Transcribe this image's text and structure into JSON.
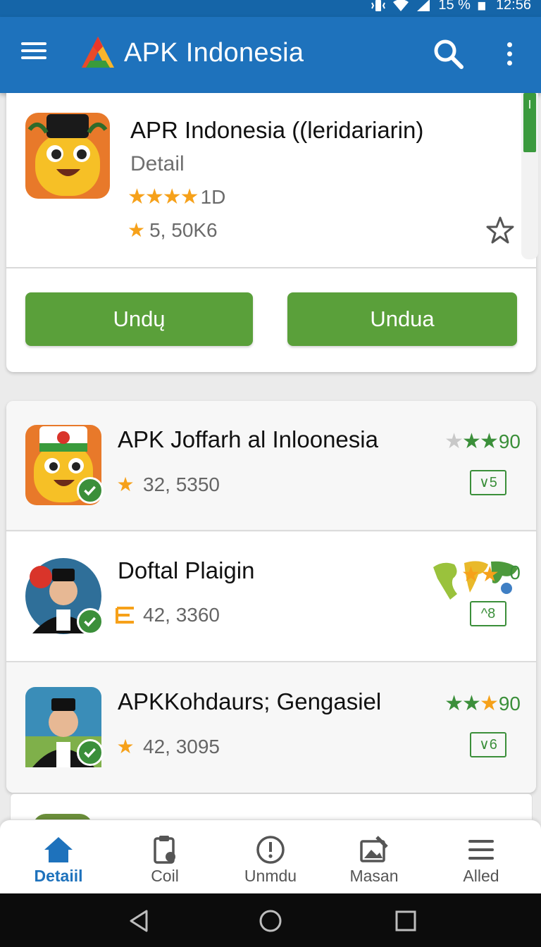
{
  "status_bar": {
    "battery": "15 %",
    "time": "12:56"
  },
  "app_bar": {
    "title": "APK Indonesia"
  },
  "featured": {
    "title": "APR Indonesia ((leridariarin)",
    "subtitle": "Detail",
    "stars": "★★★★",
    "rating": "1D",
    "count": "5, 50K6",
    "buttons": {
      "primary": "Undų",
      "secondary": "Undua"
    }
  },
  "apps": [
    {
      "title": "APK Joffarh al Inloonesia",
      "stat": "32, 5350",
      "score": "90",
      "version": "∨5"
    },
    {
      "title": "Doftal Plaigin",
      "stat": "42, 3360",
      "score": "0",
      "version": "^8"
    },
    {
      "title": "APKKohdaurs; Gengasiel",
      "stat": "42, 3095",
      "score": "90",
      "version": "∨6"
    }
  ],
  "bottom_nav": [
    {
      "label": "Detaiil",
      "icon": "home-icon",
      "active": true
    },
    {
      "label": "Coil",
      "icon": "clipboard-icon",
      "active": false
    },
    {
      "label": "Unmdu",
      "icon": "info-circle-icon",
      "active": false
    },
    {
      "label": "Masan",
      "icon": "edit-image-icon",
      "active": false
    },
    {
      "label": "Alled",
      "icon": "menu-icon",
      "active": false
    }
  ],
  "colors": {
    "primary": "#1e72bc",
    "green": "#5aa03a",
    "star": "#f6a11a",
    "verified": "#3b8f3a"
  }
}
